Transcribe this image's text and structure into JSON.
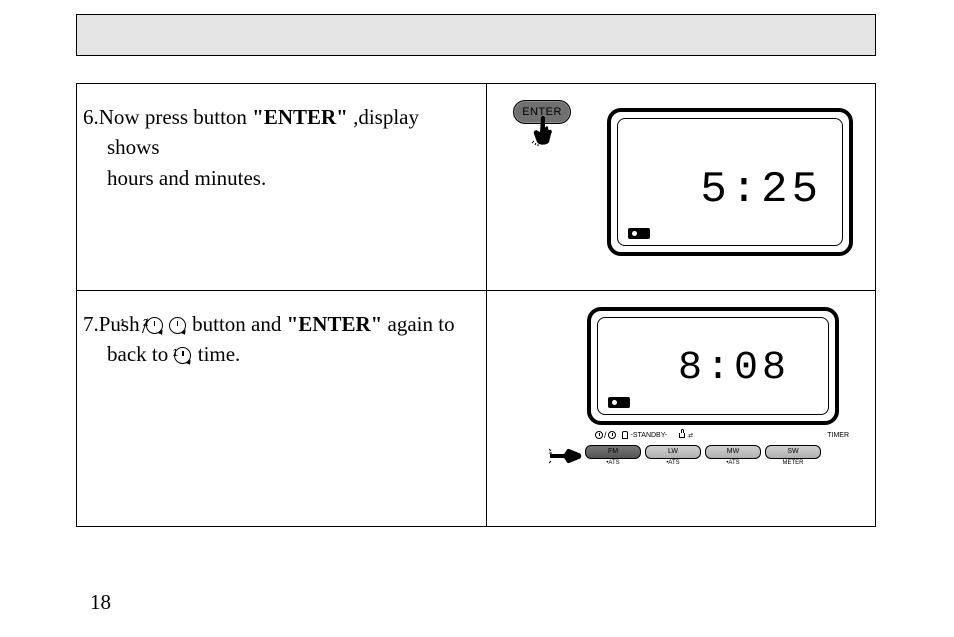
{
  "cells": {
    "step6": {
      "num": "6.",
      "t1": "Now press button  ",
      "bold": "\"ENTER\"",
      "t2": " ,display shows",
      "line2": "hours and minutes."
    },
    "step7": {
      "num": "7.",
      "t1": "Push ",
      "t2": " button and  ",
      "bold": "\"ENTER\"",
      "t3": "  again to",
      "line2a": "back to ",
      "line2b": " time."
    }
  },
  "enter_button_label": "ENTER",
  "lcd": {
    "row1_time": "5:25",
    "row2_time": "8:08"
  },
  "button_bar": {
    "top_labels": {
      "standby": "-STANDBY-",
      "timer": "TIMER"
    },
    "buttons": [
      "FM",
      "LW",
      "MW",
      "SW"
    ],
    "subs": [
      "•ATS",
      "•ATS",
      "•ATS",
      "METER"
    ]
  },
  "page_number": "18"
}
